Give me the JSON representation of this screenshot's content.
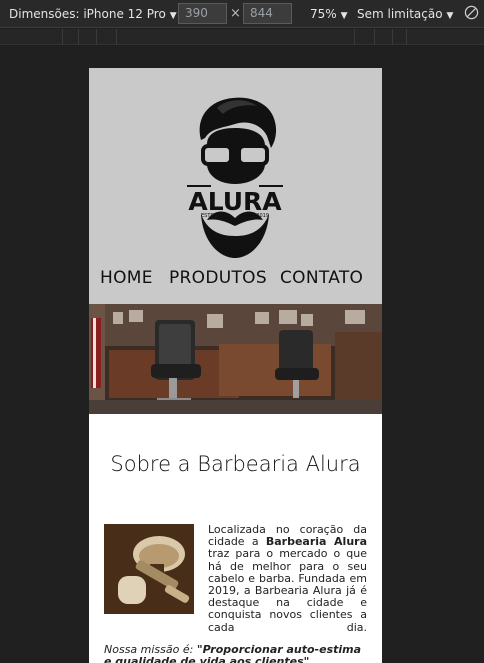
{
  "devtools": {
    "dimensions_label": "Dimensões: iPhone 12 Pro",
    "width_value": "390",
    "height_value": "844",
    "zoom": "75%",
    "throttle": "Sem limitação",
    "times_symbol": "×"
  },
  "site": {
    "logo": {
      "brand": "ALURA",
      "estd_left": "ESTD",
      "estd_right": "2019"
    },
    "nav": [
      {
        "label": "HOME"
      },
      {
        "label": "PRODUTOS"
      },
      {
        "label": "CONTATO"
      }
    ],
    "about": {
      "title": "Sobre a Barbearia Alura",
      "text_before": "Localizada no coração da cidade a ",
      "text_bold": "Barbearia Alura",
      "text_after": " traz para o mercado o que há de melhor para o seu cabelo e barba. Fundada em 2019, a Barbearia Alura já é destaque na cidade e conquista novos clientes a cada dia.",
      "mission_label": "Nossa missão é: ",
      "mission_quote": "\"Proporcionar auto-estima e qualidade de vida aos clientes\"."
    }
  },
  "colors": {
    "header_bg": "#c9c9c9",
    "devtools_bg": "#292929",
    "stage_bg": "#202020"
  }
}
